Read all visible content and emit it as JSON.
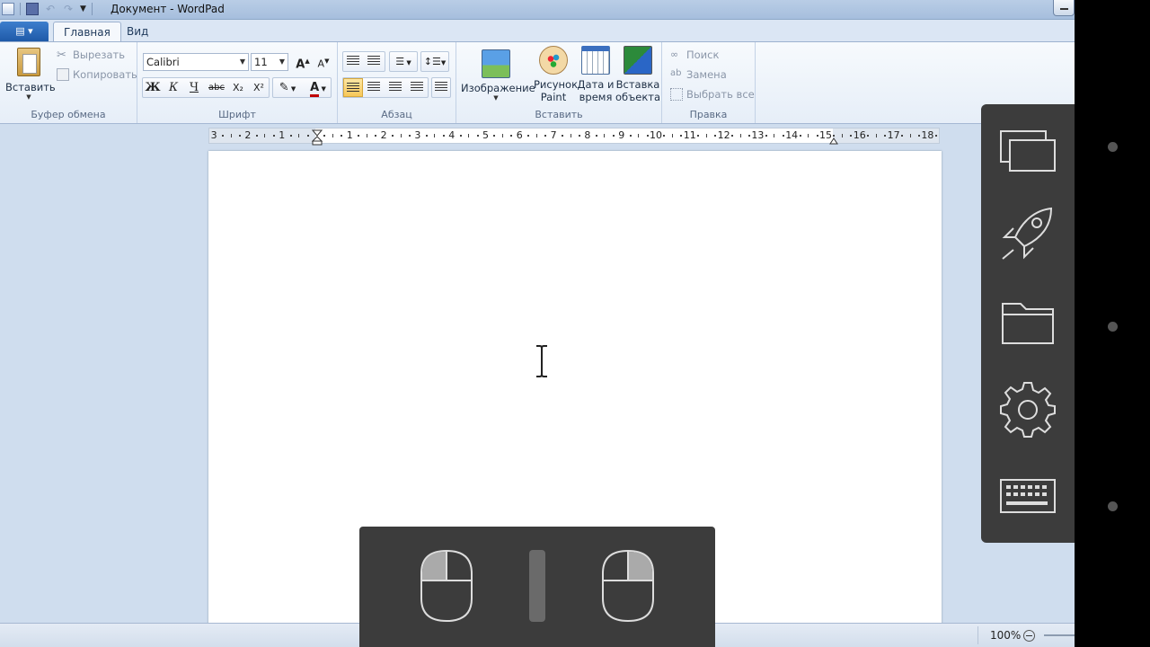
{
  "window": {
    "title": "Документ - WordPad"
  },
  "tabs": [
    {
      "label": "Главная"
    },
    {
      "label": "Вид"
    }
  ],
  "ribbon": {
    "clipboard": {
      "label": "Буфер обмена",
      "paste": "Вставить",
      "cut": "Вырезать",
      "copy": "Копировать"
    },
    "font": {
      "label": "Шрифт",
      "family": "Calibri",
      "size": "11",
      "bold": "Ж",
      "italic": "К",
      "underline": "Ч",
      "strike": "abc",
      "subscript": "X₂",
      "superscript": "X²",
      "grow": "A",
      "shrink": "A"
    },
    "paragraph": {
      "label": "Абзац"
    },
    "insert": {
      "label": "Вставить",
      "picture": "Изображение",
      "paint1": "Рисунок",
      "paint2": "Paint",
      "date1": "Дата и",
      "date2": "время",
      "object1": "Вставка",
      "object2": "объекта"
    },
    "editing": {
      "label": "Правка",
      "find": "Поиск",
      "replace": "Замена",
      "select_all": "Выбрать все"
    }
  },
  "ruler": {
    "numbers": [
      "3",
      "2",
      "1",
      "1",
      "2",
      "3",
      "4",
      "5",
      "6",
      "7",
      "8",
      "9",
      "10",
      "11",
      "12",
      "13",
      "14",
      "15",
      "16",
      "17",
      "18"
    ]
  },
  "status": {
    "zoom": "100%"
  },
  "icons": {
    "app": "wordpad-icon",
    "save": "save-icon",
    "undo": "undo-icon",
    "redo": "redo-icon",
    "text_cursor": "i-beam-cursor-icon",
    "side": [
      "windows-icon",
      "rocket-icon",
      "folder-icon",
      "gear-icon",
      "keyboard-icon"
    ]
  },
  "colors": {
    "accent": "#1f5aa8",
    "overlay": "#3c3c3c",
    "ribbon_bg": "#eef3fa",
    "workspace": "#cfddee"
  }
}
